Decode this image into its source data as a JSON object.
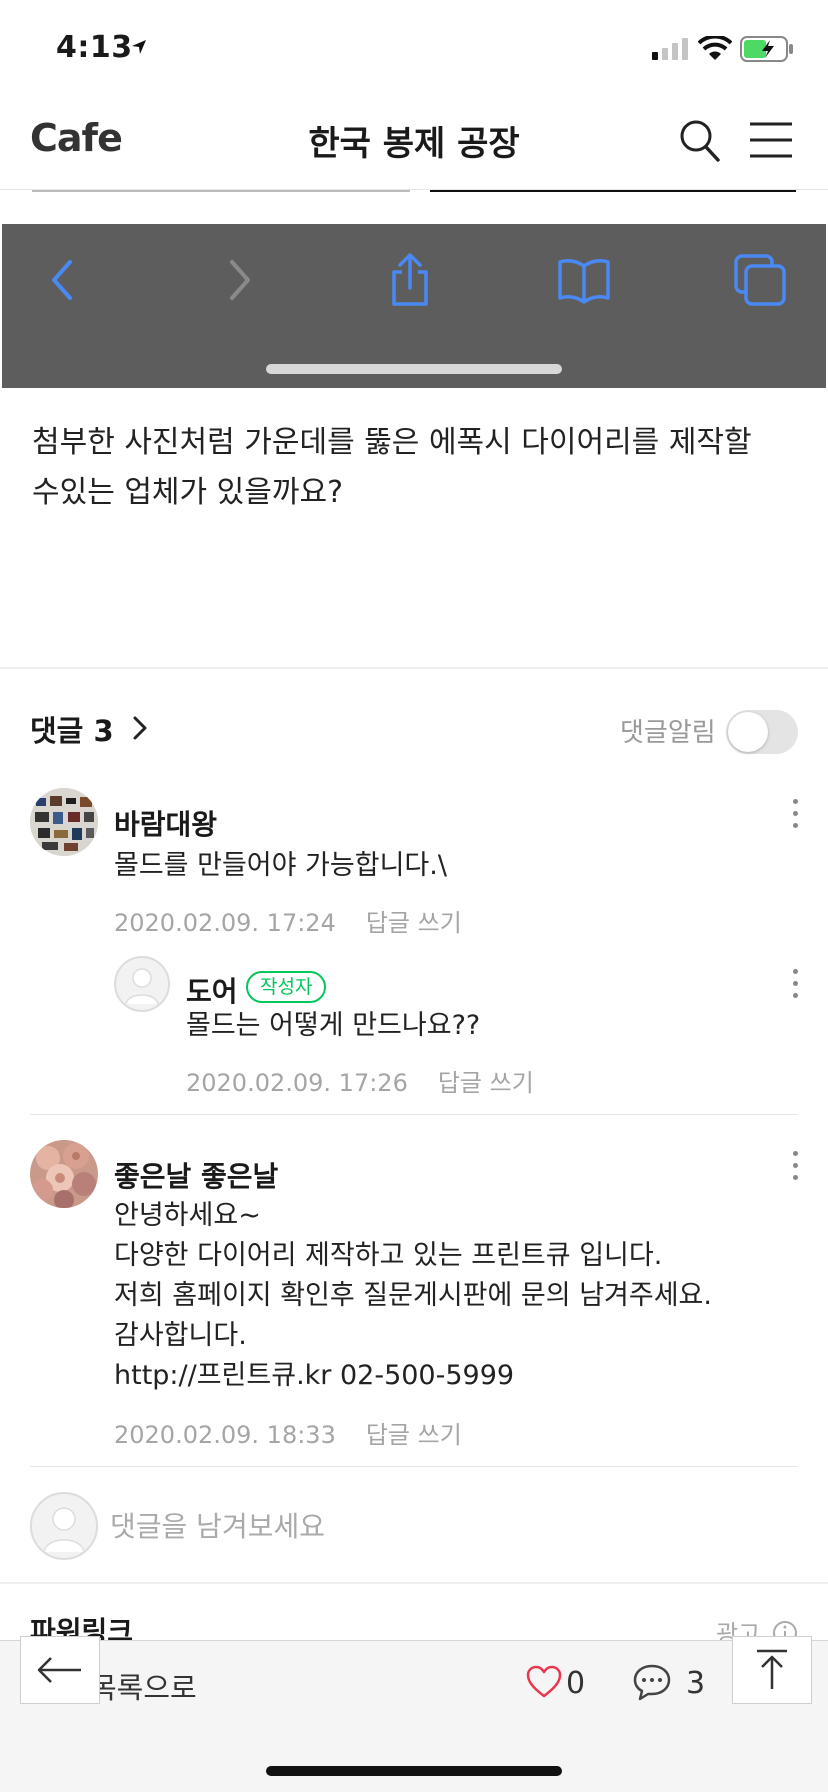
{
  "status_bar": {
    "time": "4:13"
  },
  "app_bar": {
    "logo_text": "Cafe",
    "title": "한국 봉제 공장"
  },
  "post": {
    "body_lines": [
      "첨부한 사진처럼 가운데를 뚫은 에폭시 다이어리를 제작할",
      "수있는 업체가 있을까요?"
    ]
  },
  "comments_header": {
    "label": "댓글 3",
    "notify_label": "댓글알림",
    "notify_enabled": false
  },
  "comments": [
    {
      "author": "바람대왕",
      "lines": [
        "몰드를 만들어야 가능합니다.\\"
      ],
      "date": "2020.02.09. 17:24",
      "reply_label": "답글 쓰기"
    },
    {
      "author": "도어",
      "badge": "작성자",
      "lines": [
        "몰드는 어떻게 만드나요??"
      ],
      "date": "2020.02.09. 17:26",
      "reply_label": "답글 쓰기"
    },
    {
      "author": "좋은날 좋은날",
      "lines": [
        "안녕하세요~",
        "다양한 다이어리 제작하고 있는 프린트큐 입니다.",
        "저희 홈페이지 확인후 질문게시판에 문의 남겨주세요.",
        "감사합니다.",
        "http://프린트큐.kr 02-500-5999"
      ],
      "date": "2020.02.09. 18:33",
      "reply_label": "답글 쓰기"
    }
  ],
  "comment_input": {
    "placeholder": "댓글을 남겨보세요"
  },
  "powerlink": {
    "title": "파워링크",
    "ad_label": "광고"
  },
  "bottom_bar": {
    "list_label": "목록으로",
    "like_count": "0",
    "comment_count": "3"
  },
  "colors": {
    "accent_green": "#03c75a",
    "safari_bar": "#5d5d5d",
    "safari_icon": "#4a89f3",
    "like_red": "#e8384f"
  }
}
